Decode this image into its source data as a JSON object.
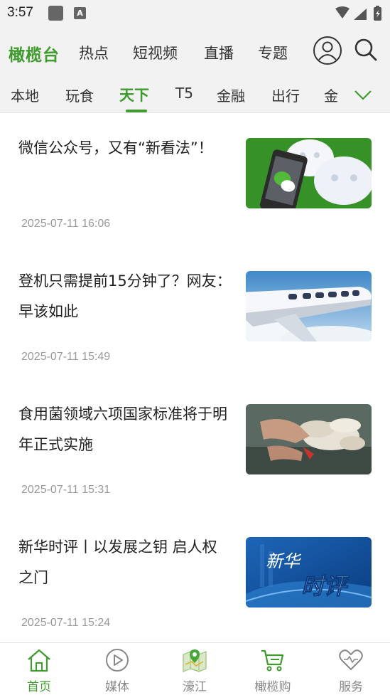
{
  "status_bar": {
    "time": "3:57",
    "notification_badge": "A"
  },
  "top_nav": {
    "brand": "橄榄台",
    "items": [
      "热点",
      "短视频",
      "直播",
      "专题"
    ]
  },
  "channels": {
    "items": [
      "本地",
      "玩食",
      "天下",
      "T5",
      "金融",
      "出行",
      "金"
    ],
    "active": "天下"
  },
  "articles": [
    {
      "title": "微信公众号，又有“新看法”！",
      "date": "2025-07-11 16:06",
      "thumb": "wechat-phone-image"
    },
    {
      "title": "登机只需提前15分钟了？网友：早该如此",
      "date": "2025-07-11 15:49",
      "thumb": "airplane-image"
    },
    {
      "title": "食用菌领域六项国家标准将于明年正式实施",
      "date": "2025-07-11 15:31",
      "thumb": "mushroom-harvest-image"
    },
    {
      "title": "新华时评丨以发展之钥 启人权之门",
      "date": "2025-07-11 15:24",
      "thumb": "xinhua-commentary-image",
      "thumb_text": {
        "line1": "新华",
        "line2": "时评"
      }
    }
  ],
  "bottom_nav": {
    "items": [
      "首页",
      "媒体",
      "濠江",
      "橄榄购",
      "服务"
    ],
    "active": "首页"
  },
  "colors": {
    "accent": "#3f9b2e",
    "bar_bg": "#f2f2f2",
    "date_text": "#9a9a9a"
  }
}
